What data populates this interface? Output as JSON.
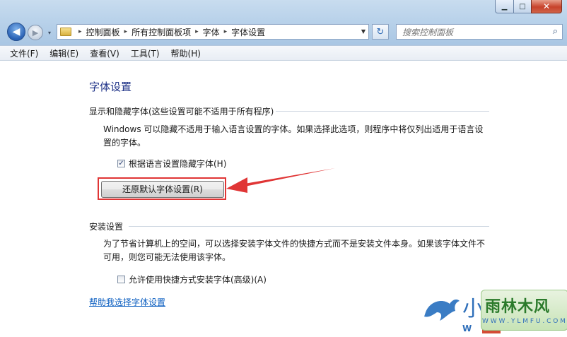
{
  "window": {
    "minimize_label": "▁",
    "maximize_label": "□",
    "close_label": "✕"
  },
  "nav": {
    "back_label": "◀",
    "forward_label": "▶",
    "recent_label": "▾",
    "breadcrumbs": [
      "控制面板",
      "所有控制面板项",
      "字体",
      "字体设置"
    ],
    "refresh_label": "↻",
    "search_placeholder": "搜索控制面板",
    "search_icon_glyph": "⌕"
  },
  "menu": [
    "文件(F)",
    "编辑(E)",
    "查看(V)",
    "工具(T)",
    "帮助(H)"
  ],
  "content": {
    "title": "字体设置",
    "group1": {
      "heading": "显示和隐藏字体(这些设置可能不适用于所有程序)",
      "description_line1": "Windows 可以隐藏不适用于输入语言设置的字体。如果选择此选项，则程序中将仅列出适用于语言设",
      "description_line2": "置的字体。",
      "checkbox_label": "根据语言设置隐藏字体(H)",
      "checkbox_checked": true,
      "button_label": "还原默认字体设置(R)"
    },
    "group2": {
      "heading": "安装设置",
      "description_line1": "为了节省计算机上的空间，可以选择安装字体文件的快捷方式而不是安装文件本身。如果该字体文件不",
      "description_line2": "可用，则您可能无法使用该字体。",
      "checkbox_label": "允许使用快捷方式安装字体(高级)(A)",
      "checkbox_checked": false
    },
    "help_link": "帮助我选择字体设置"
  },
  "annotation": {
    "highlight_color": "#e03535"
  },
  "watermark": {
    "brand": "雨林木风",
    "url": "W W W . Y L M F U . C O M",
    "partial_char": "小",
    "partial_letter": "W"
  }
}
